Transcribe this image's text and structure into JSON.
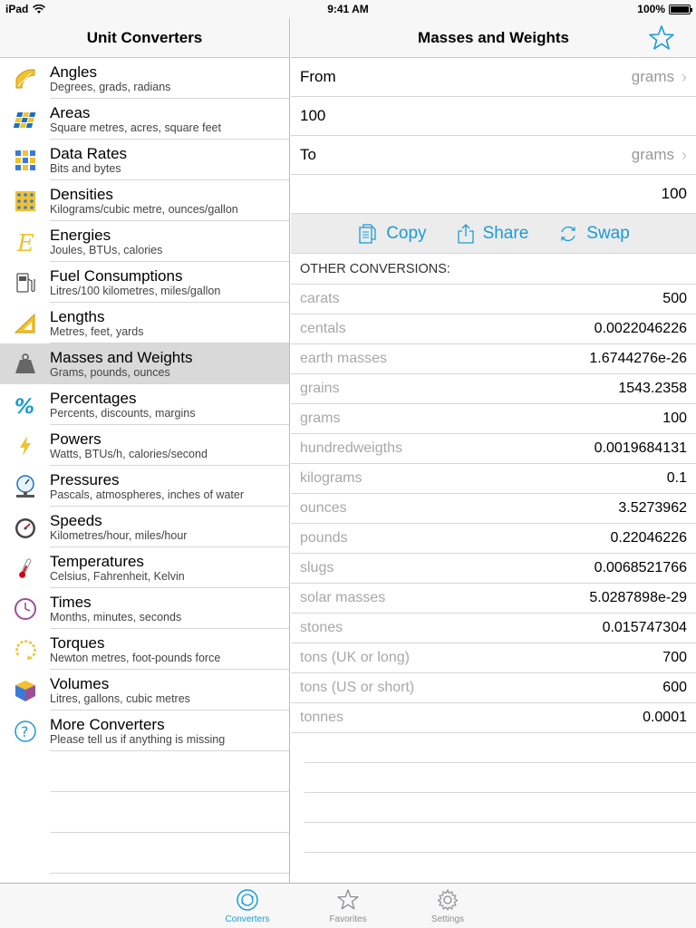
{
  "status": {
    "device": "iPad",
    "time": "9:41 AM",
    "battery": "100%"
  },
  "master": {
    "title": "Unit Converters",
    "items": [
      {
        "title": "Angles",
        "subtitle": "Degrees, grads, radians",
        "icon": "protractor-icon"
      },
      {
        "title": "Areas",
        "subtitle": "Square metres, acres, square feet",
        "icon": "tiles-icon"
      },
      {
        "title": "Data Rates",
        "subtitle": "Bits and bytes",
        "icon": "binary-icon"
      },
      {
        "title": "Densities",
        "subtitle": "Kilograms/cubic metre, ounces/gallon",
        "icon": "grid-dots-icon"
      },
      {
        "title": "Energies",
        "subtitle": "Joules, BTUs, calories",
        "icon": "energy-e-icon"
      },
      {
        "title": "Fuel Consumptions",
        "subtitle": "Litres/100 kilometres, miles/gallon",
        "icon": "fuel-pump-icon"
      },
      {
        "title": "Lengths",
        "subtitle": "Metres, feet, yards",
        "icon": "set-square-icon"
      },
      {
        "title": "Masses and Weights",
        "subtitle": "Grams, pounds, ounces",
        "icon": "weight-icon"
      },
      {
        "title": "Percentages",
        "subtitle": "Percents, discounts, margins",
        "icon": "percent-icon"
      },
      {
        "title": "Powers",
        "subtitle": "Watts, BTUs/h, calories/second",
        "icon": "lightning-icon"
      },
      {
        "title": "Pressures",
        "subtitle": "Pascals, atmospheres, inches of water",
        "icon": "pressure-gauge-icon"
      },
      {
        "title": "Speeds",
        "subtitle": "Kilometres/hour, miles/hour",
        "icon": "speedometer-icon"
      },
      {
        "title": "Temperatures",
        "subtitle": "Celsius, Fahrenheit, Kelvin",
        "icon": "thermometer-icon"
      },
      {
        "title": "Times",
        "subtitle": "Months, minutes, seconds",
        "icon": "clock-icon"
      },
      {
        "title": "Torques",
        "subtitle": "Newton metres, foot-pounds force",
        "icon": "torque-icon"
      },
      {
        "title": "Volumes",
        "subtitle": "Litres, gallons, cubic metres",
        "icon": "cube-icon"
      },
      {
        "title": "More Converters",
        "subtitle": "Please tell us if anything is missing",
        "icon": "question-icon"
      }
    ],
    "selected_index": 7
  },
  "detail": {
    "title": "Masses and Weights",
    "from_label": "From",
    "from_unit": "grams",
    "from_value": "100",
    "to_label": "To",
    "to_unit": "grams",
    "to_value": "100",
    "actions": {
      "copy": "Copy",
      "share": "Share",
      "swap": "Swap"
    },
    "other_header": "OTHER CONVERSIONS:",
    "conversions": [
      {
        "name": "carats",
        "value": "500"
      },
      {
        "name": "centals",
        "value": "0.0022046226"
      },
      {
        "name": "earth masses",
        "value": "1.6744276e-26"
      },
      {
        "name": "grains",
        "value": "1543.2358"
      },
      {
        "name": "grams",
        "value": "100"
      },
      {
        "name": "hundredweigths",
        "value": "0.0019684131"
      },
      {
        "name": "kilograms",
        "value": "0.1"
      },
      {
        "name": "ounces",
        "value": "3.5273962"
      },
      {
        "name": "pounds",
        "value": "0.22046226"
      },
      {
        "name": "slugs",
        "value": "0.0068521766"
      },
      {
        "name": "solar masses",
        "value": "5.0287898e-29"
      },
      {
        "name": "stones",
        "value": "0.015747304"
      },
      {
        "name": "tons (UK or long)",
        "value": "700"
      },
      {
        "name": "tons (US or short)",
        "value": "600"
      },
      {
        "name": "tonnes",
        "value": "0.0001"
      }
    ]
  },
  "tabbar": {
    "tabs": [
      {
        "label": "Converters",
        "icon": "converters-icon",
        "active": true
      },
      {
        "label": "Favorites",
        "icon": "star-icon",
        "active": false
      },
      {
        "label": "Settings",
        "icon": "gear-icon",
        "active": false
      }
    ]
  },
  "colors": {
    "accent": "#1b9bd7",
    "selected_row": "#d9d9d9",
    "muted_text": "#a8a8a8"
  }
}
